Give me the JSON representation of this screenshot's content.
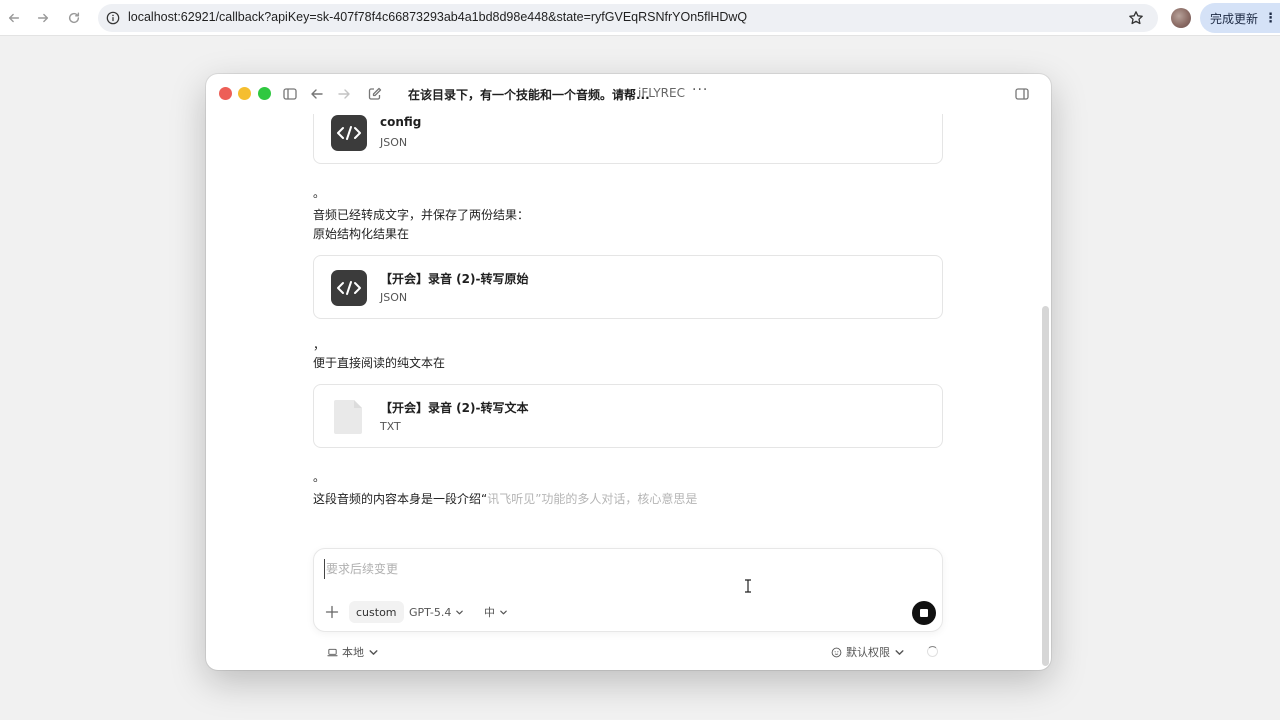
{
  "browser": {
    "url": "localhost:62921/callback?apiKey=sk-407f78f4c66873293ab4a1bd8d98e448&state=ryfGVEqRSNfrYOn5flHDwQ",
    "update_button_label": "完成更新",
    "icons": [
      "back-icon",
      "forward-icon",
      "reload-icon",
      "info-icon",
      "star-icon",
      "kebab-icon"
    ]
  },
  "window": {
    "title": "在该目录下，有一个技能和一个音频。请帮...",
    "subtitle": "iFLYREC",
    "more_label": "···"
  },
  "messages": {
    "card_config": {
      "name": "config",
      "type": "JSON"
    },
    "period_1": "。",
    "line_saved": "音频已经转成文字，并保存了两份结果：",
    "line_raw": "原始结构化结果在",
    "card_raw": {
      "name": "【开会】录音 (2)-转写原始",
      "type": "JSON"
    },
    "comma": "，",
    "line_plain": "便于直接阅读的纯文本在",
    "card_txt": {
      "name": "【开会】录音 (2)-转写文本",
      "type": "TXT"
    },
    "period_2": "。",
    "line_summary_solid": "这段音频的内容本身是一段介绍“",
    "line_summary_fade": "讯飞听见”功能的多人对话，核心意思是"
  },
  "composer": {
    "placeholder": "要求后续变更",
    "value": "",
    "custom_label": "custom",
    "model_label": "GPT-5.4",
    "reasoning_label": "中"
  },
  "footer": {
    "location_label": "本地",
    "permission_label": "默认权限"
  }
}
